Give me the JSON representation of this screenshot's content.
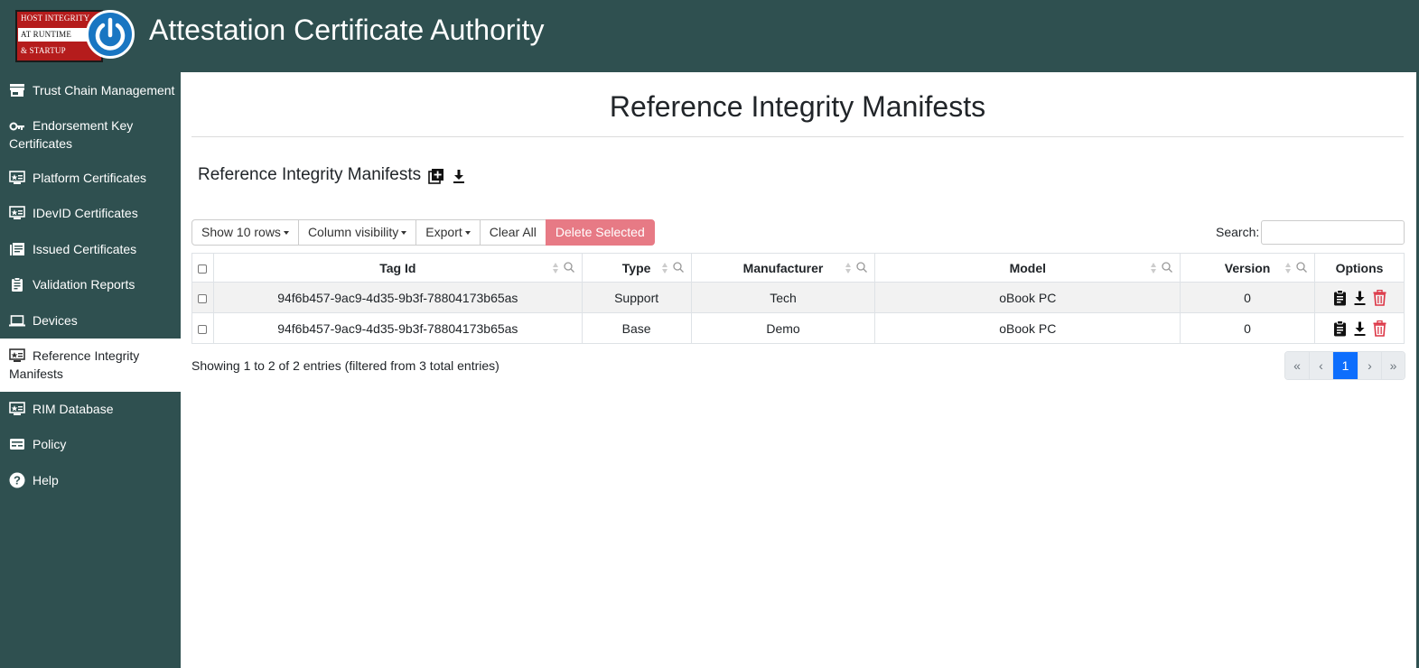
{
  "header": {
    "logo": {
      "line1": "HOST INTEGRITY",
      "line2": "AT RUNTIME",
      "line3": "& STARTUP"
    },
    "title": "Attestation Certificate Authority"
  },
  "sidebar": {
    "items": [
      {
        "label": "Trust Chain Management",
        "icon": "store-icon"
      },
      {
        "label": "Endorsement Key Certificates",
        "icon": "key-icon"
      },
      {
        "label": "Platform Certificates",
        "icon": "certificate-monitor-icon"
      },
      {
        "label": "IDevID Certificates",
        "icon": "certificate-monitor-icon"
      },
      {
        "label": "Issued Certificates",
        "icon": "stack-list-icon"
      },
      {
        "label": "Validation Reports",
        "icon": "clipboard-icon"
      },
      {
        "label": "Devices",
        "icon": "laptop-icon"
      },
      {
        "label": "Reference Integrity Manifests",
        "icon": "certificate-monitor-icon",
        "active": true
      },
      {
        "label": "RIM Database",
        "icon": "certificate-monitor-icon"
      },
      {
        "label": "Policy",
        "icon": "policy-card-icon"
      },
      {
        "label": "Help",
        "icon": "help-icon"
      }
    ]
  },
  "main": {
    "page_title": "Reference Integrity Manifests",
    "section_title": "Reference Integrity Manifests",
    "toolbar": {
      "show_rows": "Show 10 rows",
      "column_visibility": "Column visibility",
      "export": "Export",
      "clear_all": "Clear All",
      "delete_selected": "Delete Selected"
    },
    "search_label": "Search:",
    "table": {
      "headers": [
        "Tag Id",
        "Type",
        "Manufacturer",
        "Model",
        "Version",
        "Options"
      ],
      "rows": [
        {
          "tag_id": "94f6b457-9ac9-4d35-9b3f-78804173b65as",
          "type": "Support",
          "manufacturer": "Tech",
          "model": "oBook PC",
          "version": "0"
        },
        {
          "tag_id": "94f6b457-9ac9-4d35-9b3f-78804173b65as",
          "type": "Base",
          "manufacturer": "Demo",
          "model": "oBook PC",
          "version": "0"
        }
      ]
    },
    "info": "Showing 1 to 2 of 2 entries (filtered from 3 total entries)",
    "pagination": {
      "first": "«",
      "prev": "‹",
      "current": "1",
      "next": "›",
      "last": "»"
    }
  },
  "colors": {
    "sidebar_bg": "#2f5050",
    "danger_button": "#e77a85",
    "delete_icon": "#dc3545",
    "active_page": "#0d6efd"
  }
}
